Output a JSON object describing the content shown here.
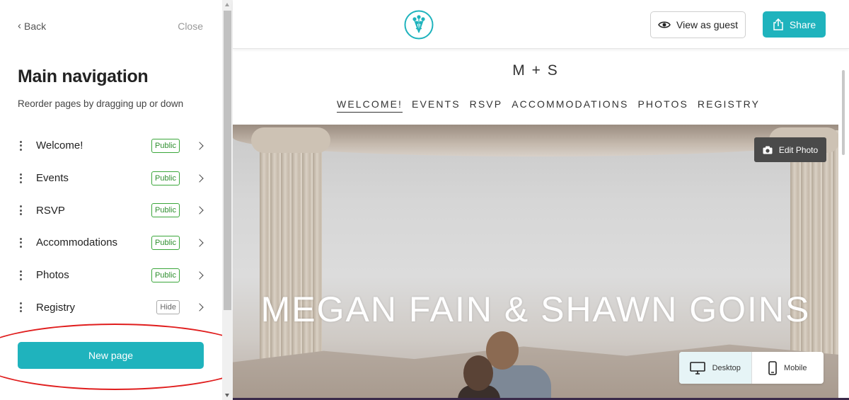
{
  "left_panel": {
    "back_label": "Back",
    "close_label": "Close",
    "title": "Main navigation",
    "subtitle": "Reorder pages by dragging up or down",
    "items": [
      {
        "label": "Welcome!",
        "badge": "Public"
      },
      {
        "label": "Events",
        "badge": "Public"
      },
      {
        "label": "RSVP",
        "badge": "Public"
      },
      {
        "label": "Accommodations",
        "badge": "Public"
      },
      {
        "label": "Photos",
        "badge": "Public"
      },
      {
        "label": "Registry",
        "badge": "Hide"
      }
    ],
    "new_page_label": "New page"
  },
  "top_bar": {
    "logo_icon": "bouquet-logo-icon",
    "view_as_guest_label": "View as guest",
    "share_label": "Share"
  },
  "site": {
    "monogram": "M + S",
    "nav": [
      "WELCOME!",
      "EVENTS",
      "RSVP",
      "ACCOMMODATIONS",
      "PHOTOS",
      "REGISTRY"
    ],
    "active_nav": "WELCOME!",
    "hero_title": "MEGAN FAIN & SHAWN GOINS",
    "edit_photo_label": "Edit Photo",
    "device_toggle": {
      "desktop_label": "Desktop",
      "mobile_label": "Mobile",
      "active": "Desktop"
    }
  },
  "colors": {
    "accent": "#1fb3bd",
    "public_badge": "#3aa63a",
    "annotation_circle": "#e01e1e"
  }
}
